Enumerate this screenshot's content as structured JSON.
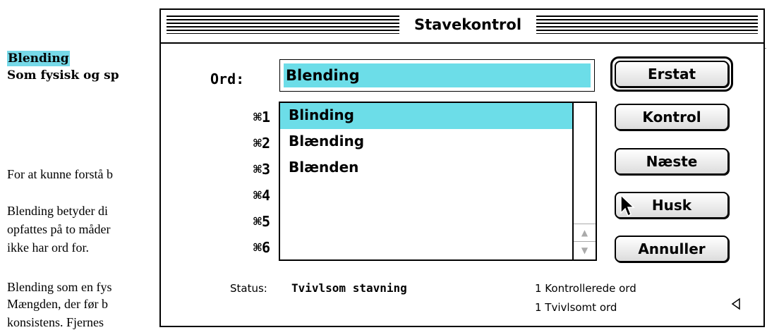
{
  "document": {
    "title": "Blending",
    "subtitle": "Som fysisk og sp",
    "paragraphs": [
      "For at kunne forstå b",
      "Blending betyder di",
      "opfattes på to måder",
      "ikke har ord for.",
      "Blending som en fys",
      "Mængden, der før b",
      "konsistens. Fjernes"
    ]
  },
  "dialog": {
    "title": "Stavekontrol",
    "word_label": "Ord:",
    "word_value": "Blending",
    "shortcuts": [
      "⌘1",
      "⌘2",
      "⌘3",
      "⌘4",
      "⌘5",
      "⌘6"
    ],
    "suggestions": [
      "Blinding",
      "Blænding",
      "Blænden"
    ],
    "selected_index": 0,
    "buttons": {
      "replace": "Erstat",
      "check": "Kontrol",
      "next": "Næste",
      "remember": "Husk",
      "cancel": "Annuller"
    },
    "status_label": "Status:",
    "status_value": "Tvivlsom stavning",
    "checked_count": "1 Kontrollerede ord",
    "doubtful_count": "1 Tvivlsomt ord",
    "icons": {
      "scroll_up": "scroll-up-arrow-icon",
      "scroll_down": "scroll-down-arrow-icon",
      "cursor": "arrow-cursor-icon",
      "expand": "triangle-left-icon"
    }
  }
}
